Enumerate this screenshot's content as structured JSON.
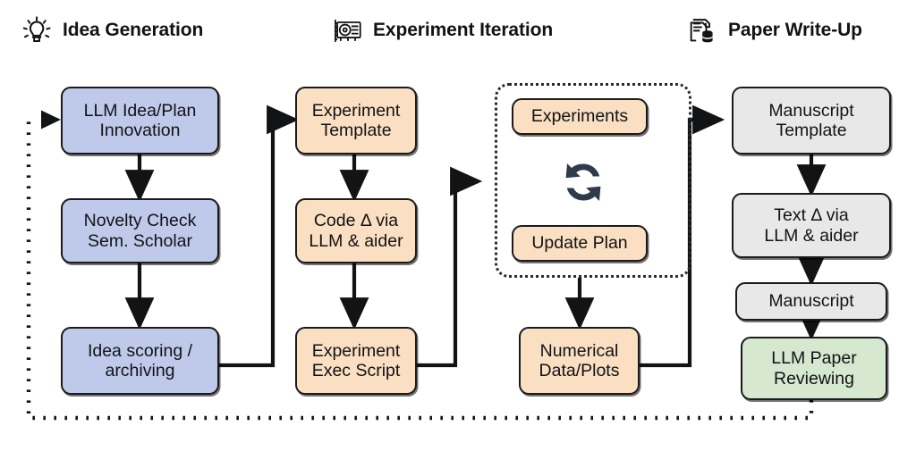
{
  "diagram": {
    "title_present": false,
    "background": "#ffffff",
    "colors": {
      "idea_blue": "#bfcaea",
      "experiment_peach": "#fadfc2",
      "manuscript_grey": "#e8e8e8",
      "review_green": "#d7e8d0",
      "stroke": "#1b1b1b",
      "cycle_icon": "#2f3b4a"
    },
    "headers": [
      {
        "id": "idea-generation",
        "label": "Idea Generation",
        "icon": "lightbulb-icon"
      },
      {
        "id": "experiment-iteration",
        "label": "Experiment Iteration",
        "icon": "gpu-card-icon"
      },
      {
        "id": "paper-write-up",
        "label": "Paper Write-Up",
        "icon": "document-database-icon"
      }
    ],
    "nodes": [
      {
        "id": "llm-idea-plan-innovation",
        "lines": [
          "LLM Idea/Plan",
          "Innovation"
        ],
        "color": "idea_blue",
        "stage": "idea-generation"
      },
      {
        "id": "novelty-check",
        "lines": [
          "Novelty Check",
          "Sem. Scholar"
        ],
        "color": "idea_blue",
        "stage": "idea-generation"
      },
      {
        "id": "idea-scoring",
        "lines": [
          "Idea scoring /",
          "archiving"
        ],
        "color": "idea_blue",
        "stage": "idea-generation"
      },
      {
        "id": "experiment-template",
        "lines": [
          "Experiment",
          "Template"
        ],
        "color": "experiment_peach",
        "stage": "experiment-iteration"
      },
      {
        "id": "code-delta",
        "lines": [
          "Code Δ via",
          "LLM & aider"
        ],
        "color": "experiment_peach",
        "stage": "experiment-iteration"
      },
      {
        "id": "experiment-exec-script",
        "lines": [
          "Experiment",
          "Exec Script"
        ],
        "color": "experiment_peach",
        "stage": "experiment-iteration"
      },
      {
        "id": "experiments",
        "lines": [
          "Experiments"
        ],
        "color": "experiment_peach",
        "stage": "experiment-iteration"
      },
      {
        "id": "update-plan",
        "lines": [
          "Update Plan"
        ],
        "color": "experiment_peach",
        "stage": "experiment-iteration"
      },
      {
        "id": "numerical-data-plots",
        "lines": [
          "Numerical",
          "Data/Plots"
        ],
        "color": "experiment_peach",
        "stage": "experiment-iteration"
      },
      {
        "id": "manuscript-template",
        "lines": [
          "Manuscript",
          "Template"
        ],
        "color": "manuscript_grey",
        "stage": "paper-write-up"
      },
      {
        "id": "text-delta",
        "lines": [
          "Text Δ via",
          "LLM & aider"
        ],
        "color": "manuscript_grey",
        "stage": "paper-write-up"
      },
      {
        "id": "manuscript",
        "lines": [
          "Manuscript"
        ],
        "color": "manuscript_grey",
        "stage": "paper-write-up"
      },
      {
        "id": "llm-paper-reviewing",
        "lines": [
          "LLM Paper",
          "Reviewing"
        ],
        "color": "review_green",
        "stage": "paper-write-up"
      }
    ],
    "loop_group": {
      "id": "experiment-loop-group",
      "style": "dotted",
      "contains": [
        "experiments",
        "update-plan"
      ],
      "icon": "refresh-cycle-icon"
    },
    "edges": [
      {
        "from": "llm-idea-plan-innovation",
        "to": "novelty-check",
        "style": "solid"
      },
      {
        "from": "novelty-check",
        "to": "idea-scoring",
        "style": "solid"
      },
      {
        "from": "idea-scoring",
        "to": "experiment-template",
        "style": "solid"
      },
      {
        "from": "experiment-template",
        "to": "code-delta",
        "style": "solid"
      },
      {
        "from": "code-delta",
        "to": "experiment-exec-script",
        "style": "solid"
      },
      {
        "from": "experiment-exec-script",
        "to": "experiment-loop-group",
        "style": "solid"
      },
      {
        "from": "experiment-loop-group",
        "to": "numerical-data-plots",
        "style": "solid"
      },
      {
        "from": "numerical-data-plots",
        "to": "manuscript-template",
        "style": "solid"
      },
      {
        "from": "manuscript-template",
        "to": "text-delta",
        "style": "solid"
      },
      {
        "from": "text-delta",
        "to": "manuscript",
        "style": "solid"
      },
      {
        "from": "manuscript",
        "to": "llm-paper-reviewing",
        "style": "solid"
      },
      {
        "from": "llm-paper-reviewing",
        "to": "llm-idea-plan-innovation",
        "style": "dotted"
      }
    ]
  }
}
